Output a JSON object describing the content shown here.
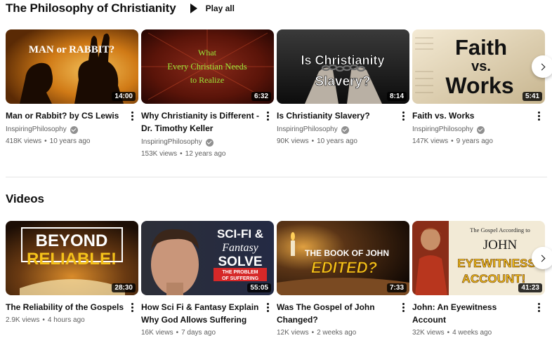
{
  "shelf1": {
    "title": "The Philosophy of Christianity",
    "play_all": "Play all",
    "videos": [
      {
        "title_lines": [
          "Man or Rabbit? by CS Lewis"
        ],
        "channel": "InspiringPhilosophy",
        "views": "418K views",
        "age": "10 years ago",
        "duration": "14:00",
        "thumb_text": [
          "MAN or RABBIT?"
        ]
      },
      {
        "title_lines": [
          "Why Christianity is Different -",
          "Dr. Timothy Keller"
        ],
        "channel": "InspiringPhilosophy",
        "views": "153K views",
        "age": "12 years ago",
        "duration": "6:32",
        "thumb_text": [
          "What",
          "Every Christian Needs",
          "to Realize"
        ]
      },
      {
        "title_lines": [
          "Is Christianity Slavery?"
        ],
        "channel": "InspiringPhilosophy",
        "views": "90K views",
        "age": "10 years ago",
        "duration": "8:14",
        "thumb_text": [
          "Is Christianity",
          "Slavery?"
        ]
      },
      {
        "title_lines": [
          "Faith vs. Works"
        ],
        "channel": "InspiringPhilosophy",
        "views": "147K views",
        "age": "9 years ago",
        "duration": "5:41",
        "thumb_text": [
          "Faith",
          "vs.",
          "Works"
        ]
      }
    ]
  },
  "shelf2": {
    "title": "Videos",
    "videos": [
      {
        "title_lines": [
          "The Reliability of the Gospels"
        ],
        "views": "2.9K views",
        "age": "4 hours ago",
        "duration": "28:30",
        "thumb_text": [
          "BEYOND",
          "RELIABLE!"
        ]
      },
      {
        "title_lines": [
          "How Sci Fi & Fantasy Explain",
          "Why God Allows Suffering"
        ],
        "views": "16K views",
        "age": "7 days ago",
        "duration": "55:05",
        "thumb_text": [
          "SCI-FI &",
          "Fantasy",
          "SOLVE",
          "THE PROBLEM",
          "OF SUFFERING"
        ]
      },
      {
        "title_lines": [
          "Was The Gospel of John",
          "Changed?"
        ],
        "views": "12K views",
        "age": "2 weeks ago",
        "duration": "7:33",
        "thumb_text": [
          "THE BOOK OF JOHN",
          "EDITED?"
        ]
      },
      {
        "title_lines": [
          "John: An Eyewitness Account"
        ],
        "views": "32K views",
        "age": "4 weeks ago",
        "duration": "41:23",
        "thumb_text": [
          "The Gospel According to",
          "JOHN",
          "EYEWITNESS",
          "ACCOUNT!"
        ]
      }
    ]
  },
  "separator": "•",
  "icons": {
    "play_all": "play-icon",
    "more": "more-vert-icon",
    "verified": "verified-check-icon",
    "next": "chevron-right-icon"
  },
  "colors": {
    "text_primary": "#0f0f0f",
    "text_secondary": "#606060",
    "duration_bg": "#000000",
    "divider": "#e5e5e5"
  }
}
